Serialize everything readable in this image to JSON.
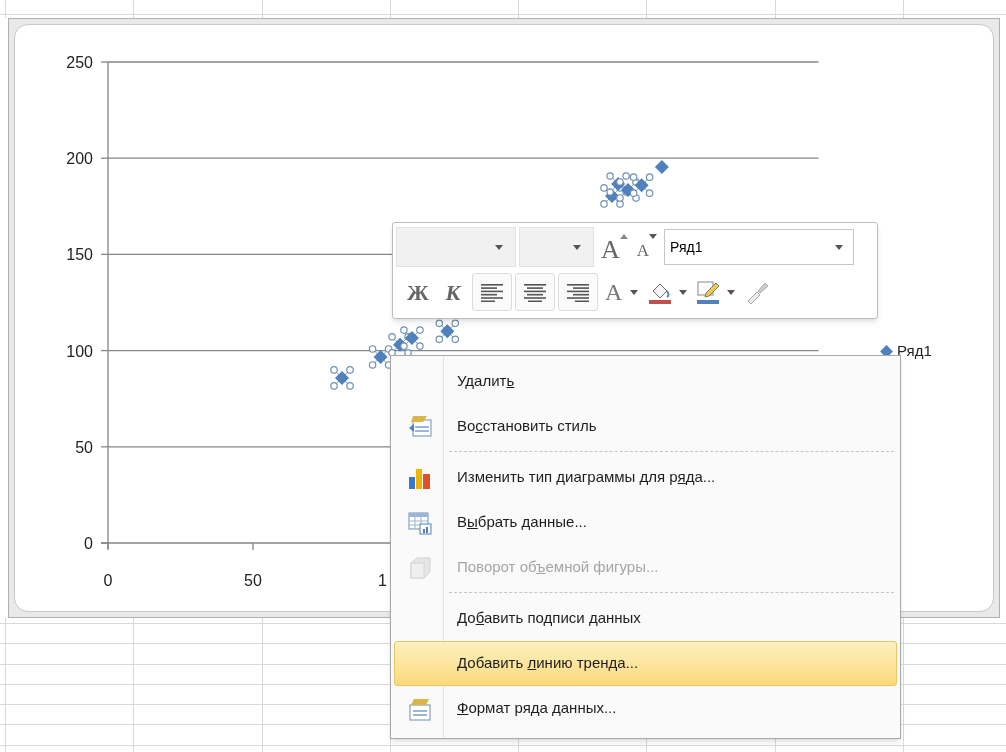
{
  "chart": {
    "series_selected": true,
    "cut_tick_label": "1",
    "chart_data": {
      "type": "scatter",
      "grid": true,
      "xlim": [
        0,
        245
      ],
      "ylim": [
        0,
        250
      ],
      "xticks": [
        0,
        50
      ],
      "yticks": [
        0,
        50,
        100,
        150,
        200,
        250
      ],
      "x": [
        80.7,
        94,
        100.7,
        104.8,
        117,
        173.8,
        175.9,
        179.3,
        184,
        191
      ],
      "series": [
        {
          "name": "Ряд1",
          "color": "#4f81bd",
          "values": [
            85.8,
            96.7,
            103,
            106.5,
            110,
            180.4,
            186.6,
            183.5,
            186,
            195.4
          ]
        }
      ]
    }
  },
  "mini_toolbar": {
    "series_box": {
      "value": "Ряд1"
    },
    "buttons": [
      {
        "kind": "grow",
        "label": "A"
      },
      {
        "kind": "shrink",
        "label": "A"
      },
      {
        "kind": "bold",
        "label": "Ж"
      },
      {
        "kind": "italic",
        "label": "К"
      },
      {
        "kind": "align-left"
      },
      {
        "kind": "align-center"
      },
      {
        "kind": "align-right"
      },
      {
        "kind": "font-color",
        "label": "A"
      },
      {
        "kind": "fill"
      },
      {
        "kind": "outline"
      },
      {
        "kind": "painter"
      }
    ]
  },
  "context_menu": {
    "items": [
      {
        "kind": "item",
        "before": "Удалит",
        "hotkey": "ь",
        "disabled": false,
        "selected": false
      },
      {
        "kind": "item",
        "before": "Во",
        "hotkey": "с",
        "after": "становить стиль",
        "disabled": false,
        "selected": false
      },
      {
        "kind": "separator"
      },
      {
        "kind": "item",
        "before": "Изменить тип диаграммы для р",
        "hotkey": "я",
        "after": "да...",
        "disabled": false,
        "selected": false
      },
      {
        "kind": "item",
        "before": "В",
        "hotkey": "ы",
        "after": "брать данные...",
        "disabled": false,
        "selected": false
      },
      {
        "kind": "item",
        "before": "Поворот об",
        "hotkey": "ъ",
        "after": "емной фигуры...",
        "disabled": true,
        "selected": false
      },
      {
        "kind": "separator"
      },
      {
        "kind": "item",
        "before": "До",
        "hotkey": "б",
        "after": "авить подписи данных",
        "disabled": false,
        "selected": false
      },
      {
        "kind": "item",
        "before": "Добавить ",
        "hotkey": "л",
        "after": "инию тренда...",
        "disabled": false,
        "selected": true
      },
      {
        "kind": "item",
        "hotkey": "Ф",
        "after": "ормат ряда данных...",
        "disabled": false,
        "selected": false
      }
    ]
  }
}
